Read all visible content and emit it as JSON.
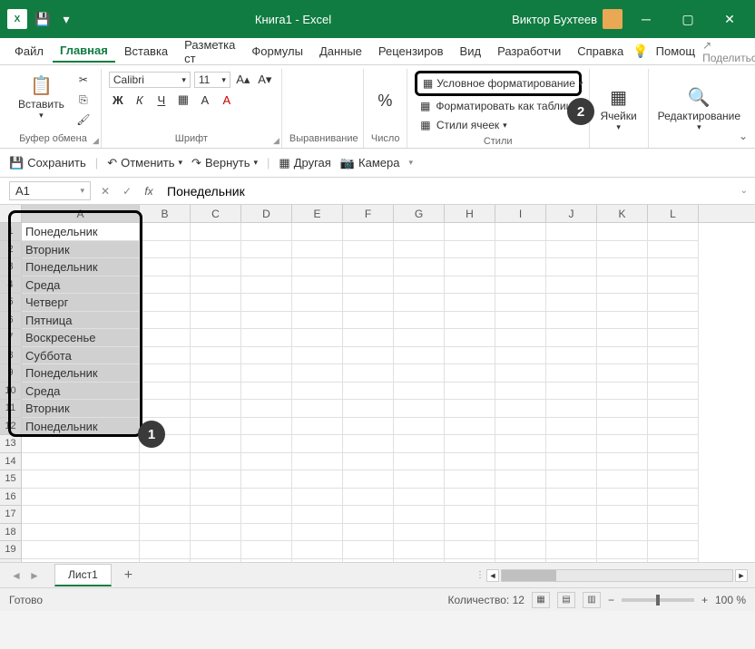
{
  "titlebar": {
    "doc_title": "Книга1 - Excel",
    "user_name": "Виктор Бухтеев"
  },
  "menu": {
    "items": [
      "Файл",
      "Главная",
      "Вставка",
      "Разметка ст",
      "Формулы",
      "Данные",
      "Рецензиров",
      "Вид",
      "Разработчи",
      "Справка"
    ],
    "active_index": 1,
    "help": "Помощ",
    "share": "Поделиться"
  },
  "ribbon": {
    "clipboard": {
      "paste": "Вставить",
      "label": "Буфер обмена"
    },
    "font": {
      "name": "Calibri",
      "size": "11",
      "label": "Шрифт"
    },
    "alignment": {
      "label": "Выравнивание"
    },
    "number": {
      "label": "Число",
      "percent": "%"
    },
    "styles": {
      "conditional": "Условное форматирование",
      "as_table": "Форматировать как таблицу",
      "cell_styles": "Стили ячеек",
      "label": "Стили"
    },
    "cells": {
      "label": "Ячейки"
    },
    "editing": {
      "label": "Редактирование"
    }
  },
  "qat": {
    "save": "Сохранить",
    "undo": "Отменить",
    "redo": "Вернуть",
    "other": "Другая",
    "camera": "Камера"
  },
  "formula_bar": {
    "name_box": "A1",
    "formula": "Понедельник"
  },
  "columns": [
    "A",
    "B",
    "C",
    "D",
    "E",
    "F",
    "G",
    "H",
    "I",
    "J",
    "K",
    "L"
  ],
  "cells_A": [
    "Понедельник",
    "Вторник",
    "Понедельник",
    "Среда",
    "Четверг",
    "Пятница",
    "Воскресенье",
    "Суббота",
    "Понедельник",
    "Среда",
    "Вторник",
    "Понедельник"
  ],
  "selection": {
    "active": "A1",
    "range_end": "A12"
  },
  "sheet_tabs": {
    "active": "Лист1"
  },
  "statusbar": {
    "ready": "Готово",
    "count_label": "Количество:",
    "count_value": "12",
    "zoom": "100 %"
  },
  "callouts": {
    "one": "1",
    "two": "2"
  }
}
